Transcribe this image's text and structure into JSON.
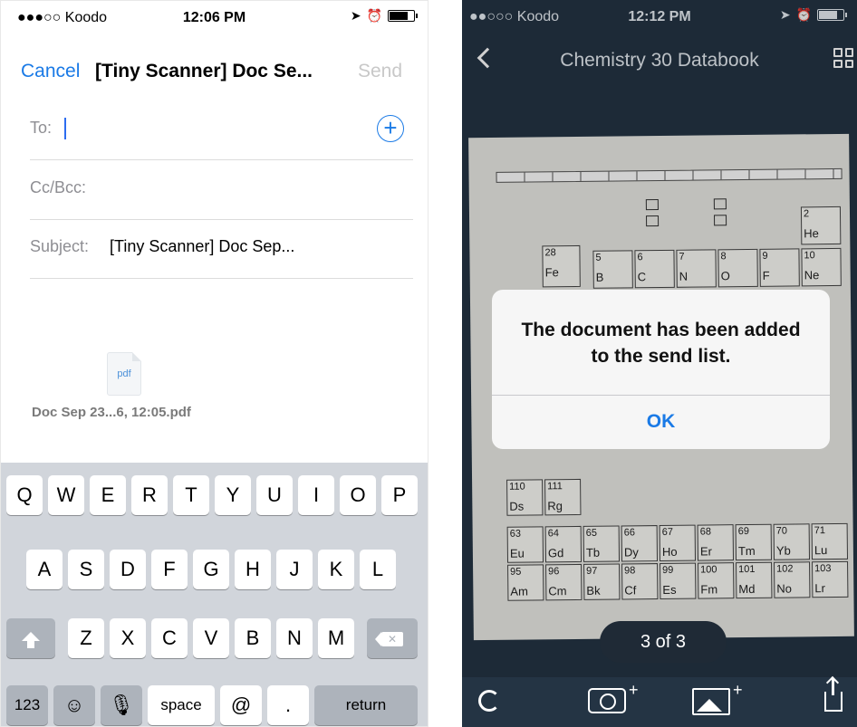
{
  "left": {
    "status": {
      "carrier": "●●●○○ Koodo",
      "time": "12:06 PM"
    },
    "nav": {
      "cancel": "Cancel",
      "title": "[Tiny Scanner] Doc Se...",
      "send": "Send"
    },
    "fields": {
      "to_label": "To:",
      "ccbcc_label": "Cc/Bcc:",
      "subject_label": "Subject:",
      "subject_value": "[Tiny Scanner] Doc Sep..."
    },
    "attachment": {
      "type": "pdf",
      "name": "Doc Sep 23...6, 12:05.pdf"
    },
    "keyboard": {
      "row1": [
        "Q",
        "W",
        "E",
        "R",
        "T",
        "Y",
        "U",
        "I",
        "O",
        "P"
      ],
      "row2": [
        "A",
        "S",
        "D",
        "F",
        "G",
        "H",
        "J",
        "K",
        "L"
      ],
      "row3": [
        "Z",
        "X",
        "C",
        "V",
        "B",
        "N",
        "M"
      ],
      "num": "123",
      "emoji": "☺",
      "mic": "🎙",
      "space": "space",
      "at": "@",
      "dot": ".",
      "return": "return"
    }
  },
  "right": {
    "status": {
      "carrier": "●●○○○ Koodo",
      "time": "12:12 PM"
    },
    "nav": {
      "title": "Chemistry 30 Databook"
    },
    "scan": {
      "cells": [
        {
          "num": "28",
          "sym": "Fe"
        },
        {
          "num": "5",
          "sym": "B"
        },
        {
          "num": "6",
          "sym": "C"
        },
        {
          "num": "7",
          "sym": "N"
        },
        {
          "num": "8",
          "sym": "O"
        },
        {
          "num": "9",
          "sym": "F"
        },
        {
          "num": "10",
          "sym": "Ne"
        },
        {
          "num": "2",
          "sym": "He"
        },
        {
          "num": "110",
          "sym": "Ds"
        },
        {
          "num": "111",
          "sym": "Rg"
        },
        {
          "num": "63",
          "sym": "Eu"
        },
        {
          "num": "64",
          "sym": "Gd"
        },
        {
          "num": "65",
          "sym": "Tb"
        },
        {
          "num": "66",
          "sym": "Dy"
        },
        {
          "num": "67",
          "sym": "Ho"
        },
        {
          "num": "68",
          "sym": "Er"
        },
        {
          "num": "69",
          "sym": "Tm"
        },
        {
          "num": "70",
          "sym": "Yb"
        },
        {
          "num": "71",
          "sym": "Lu"
        },
        {
          "num": "95",
          "sym": "Am"
        },
        {
          "num": "96",
          "sym": "Cm"
        },
        {
          "num": "97",
          "sym": "Bk"
        },
        {
          "num": "98",
          "sym": "Cf"
        },
        {
          "num": "99",
          "sym": "Es"
        },
        {
          "num": "100",
          "sym": "Fm"
        },
        {
          "num": "101",
          "sym": "Md"
        },
        {
          "num": "102",
          "sym": "No"
        },
        {
          "num": "103",
          "sym": "Lr"
        }
      ]
    },
    "alert": {
      "message": "The document has been added to the send list.",
      "ok": "OK"
    },
    "page_indicator": "3 of 3",
    "toolbar_plus": "+"
  }
}
